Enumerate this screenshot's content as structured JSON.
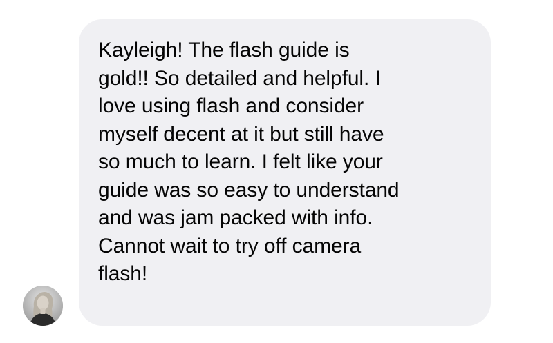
{
  "conversation": {
    "message": {
      "text": "Kayleigh! The flash guide is\ngold!! So detailed and helpful. I\nlove using flash and consider\nmyself decent at it but still have\nso much to learn. I felt like your\nguide was so easy to understand\nand was jam packed with info.\nCannot wait to try off camera\nflash!"
    },
    "avatar": {
      "icon": "profile-photo-avatar"
    }
  },
  "colors": {
    "background": "#ffffff",
    "bubble": "#f0f0f3",
    "text": "#050505"
  }
}
